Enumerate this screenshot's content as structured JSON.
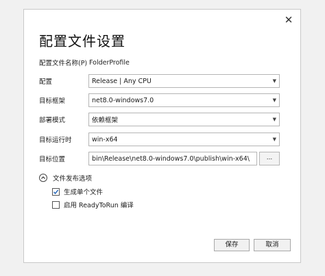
{
  "dialog": {
    "title": "配置文件设置",
    "close_glyph": "✕"
  },
  "fields": {
    "profile_name": {
      "label": "配置文件名称(P)",
      "value": "FolderProfile"
    },
    "configuration": {
      "label": "配置",
      "value": "Release | Any CPU"
    },
    "target_framework": {
      "label": "目标框架",
      "value": "net8.0-windows7.0"
    },
    "deployment_mode": {
      "label": "部署模式",
      "value": "依赖框架"
    },
    "target_runtime": {
      "label": "目标运行时",
      "value": "win-x64"
    },
    "target_location": {
      "label": "目标位置",
      "value": "bin\\Release\\net8.0-windows7.0\\publish\\win-x64\\",
      "browse_label": "..."
    }
  },
  "publish_options": {
    "label": "文件发布选项",
    "expanded": true,
    "options": [
      {
        "label": "生成单个文件",
        "checked": true
      },
      {
        "label": "启用 ReadyToRun 编译",
        "checked": false
      }
    ]
  },
  "footer": {
    "save_label": "保存",
    "cancel_label": "取消"
  },
  "icons": {
    "close": "close-icon",
    "caret": "chevron-down-icon",
    "expander": "chevron-up-icon",
    "check": "check-icon"
  },
  "colors": {
    "check_accent": "#1a5fb4",
    "border": "#b5b5b5"
  }
}
